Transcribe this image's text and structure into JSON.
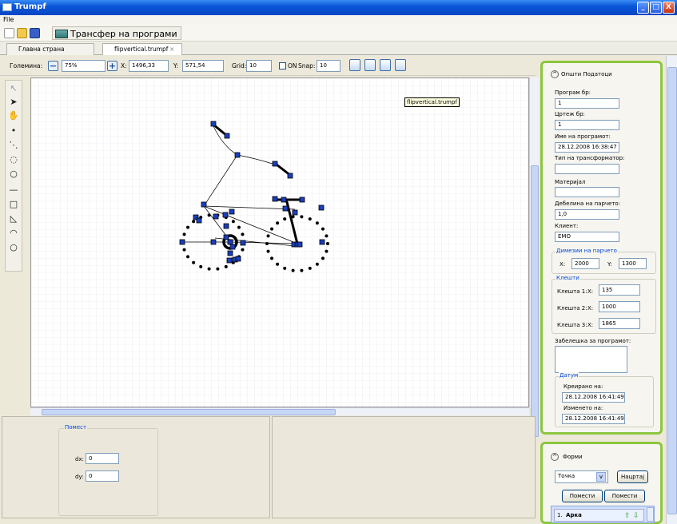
{
  "window": {
    "title": "Trumpf",
    "buttons": {
      "min": "_",
      "max": "□",
      "close": "X"
    }
  },
  "menu": {
    "file": "File"
  },
  "toolbar": {
    "transfer_label": "Трансфер на програми"
  },
  "tabs": [
    {
      "label": "Главна страна"
    },
    {
      "label": "flipvertical.trumpf"
    }
  ],
  "tab_close": "×",
  "canvas_toolbar": {
    "size_label": "Големина:",
    "zoom": "75%",
    "x_label": "X:",
    "x_value": "1496,33",
    "y_label": "Y:",
    "y_value": "571,54",
    "grid_label": "Grid:",
    "grid_value": "10",
    "on_label": "ON",
    "snap_label": "Snap:",
    "snap_value": "10"
  },
  "canvas": {
    "tooltip": "flipvertical.trumpf"
  },
  "bottom": {
    "group_title": "Помест",
    "dx_label": "dx:",
    "dx_value": "0",
    "dy_label": "dy:",
    "dy_value": "0"
  },
  "general": {
    "title": "Општи Податоци",
    "program_no_label": "Програм бр:",
    "program_no": "1",
    "drawing_no_label": "Цртеж бр:",
    "drawing_no": "1",
    "program_name_label": "Име на програмот:",
    "program_name": "28.12.2008 16:38:47",
    "transformer_type_label": "Тип на трансформатор:",
    "transformer_type": "",
    "material_label": "Материјал",
    "material": "",
    "thickness_label": "Дебелина на парчето:",
    "thickness": "1,0",
    "client_label": "Клиент:",
    "client": "EMO",
    "dims_title": "Димезии на парчето",
    "dim_x_label": "X:",
    "dim_x": "2000",
    "dim_y_label": "Y:",
    "dim_y": "1300",
    "clamps_title": "Клешти",
    "clamps": [
      {
        "label": "Клешта 1:",
        "x_label": "X:",
        "x": "135"
      },
      {
        "label": "Клешта 2:",
        "x_label": "X:",
        "x": "1000"
      },
      {
        "label": "Клешта 3:",
        "x_label": "X:",
        "x": "1865"
      }
    ],
    "note_label": "Забелешка за програмот:",
    "note": "",
    "date_title": "Датум",
    "created_label": "Креирано на:",
    "created": "28.12.2008 16:41:49",
    "modified_label": "Изменето на:",
    "modified": "28.12.2008 16:41:49"
  },
  "shapes": {
    "title": "Форми",
    "shape_select": "Точка",
    "draw_button": "Нацртај",
    "move_up": "Помести горе",
    "move_down": "Помести доле",
    "list": [
      {
        "index": "1.",
        "name": "Арка"
      }
    ]
  }
}
